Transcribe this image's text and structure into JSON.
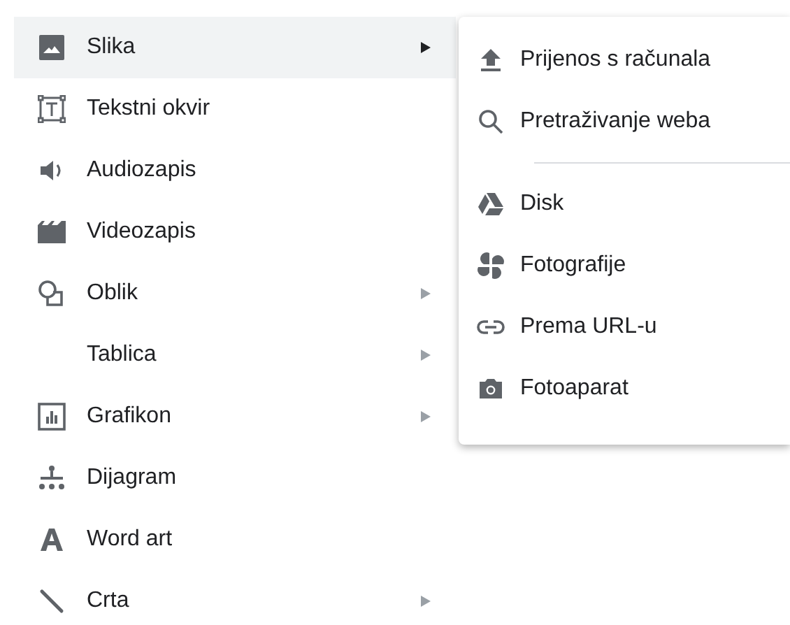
{
  "menu": {
    "items": [
      {
        "label": "Slika",
        "kind": "image",
        "has_submenu": true,
        "selected": true
      },
      {
        "label": "Tekstni okvir",
        "kind": "textbox",
        "has_submenu": false,
        "selected": false
      },
      {
        "label": "Audiozapis",
        "kind": "audio",
        "has_submenu": false,
        "selected": false
      },
      {
        "label": "Videozapis",
        "kind": "video",
        "has_submenu": false,
        "selected": false
      },
      {
        "label": "Oblik",
        "kind": "shape",
        "has_submenu": true,
        "selected": false
      },
      {
        "label": "Tablica",
        "has_submenu": true,
        "selected": false
      },
      {
        "label": "Grafikon",
        "kind": "chart",
        "has_submenu": true,
        "selected": false
      },
      {
        "label": "Dijagram",
        "kind": "diagram",
        "has_submenu": false,
        "selected": false
      },
      {
        "label": "Word art",
        "kind": "wordart",
        "has_submenu": false,
        "selected": false
      },
      {
        "label": "Crta",
        "kind": "line",
        "has_submenu": true,
        "selected": false
      }
    ]
  },
  "submenu": {
    "groups": [
      [
        {
          "label": "Prijenos s računala",
          "kind": "upload"
        },
        {
          "label": "Pretraživanje weba",
          "kind": "search"
        }
      ],
      [
        {
          "label": "Disk",
          "kind": "drive"
        },
        {
          "label": "Fotografije",
          "kind": "pinwheel"
        },
        {
          "label": "Prema URL-u",
          "kind": "link"
        },
        {
          "label": "Fotoaparat",
          "kind": "camera"
        }
      ]
    ]
  }
}
